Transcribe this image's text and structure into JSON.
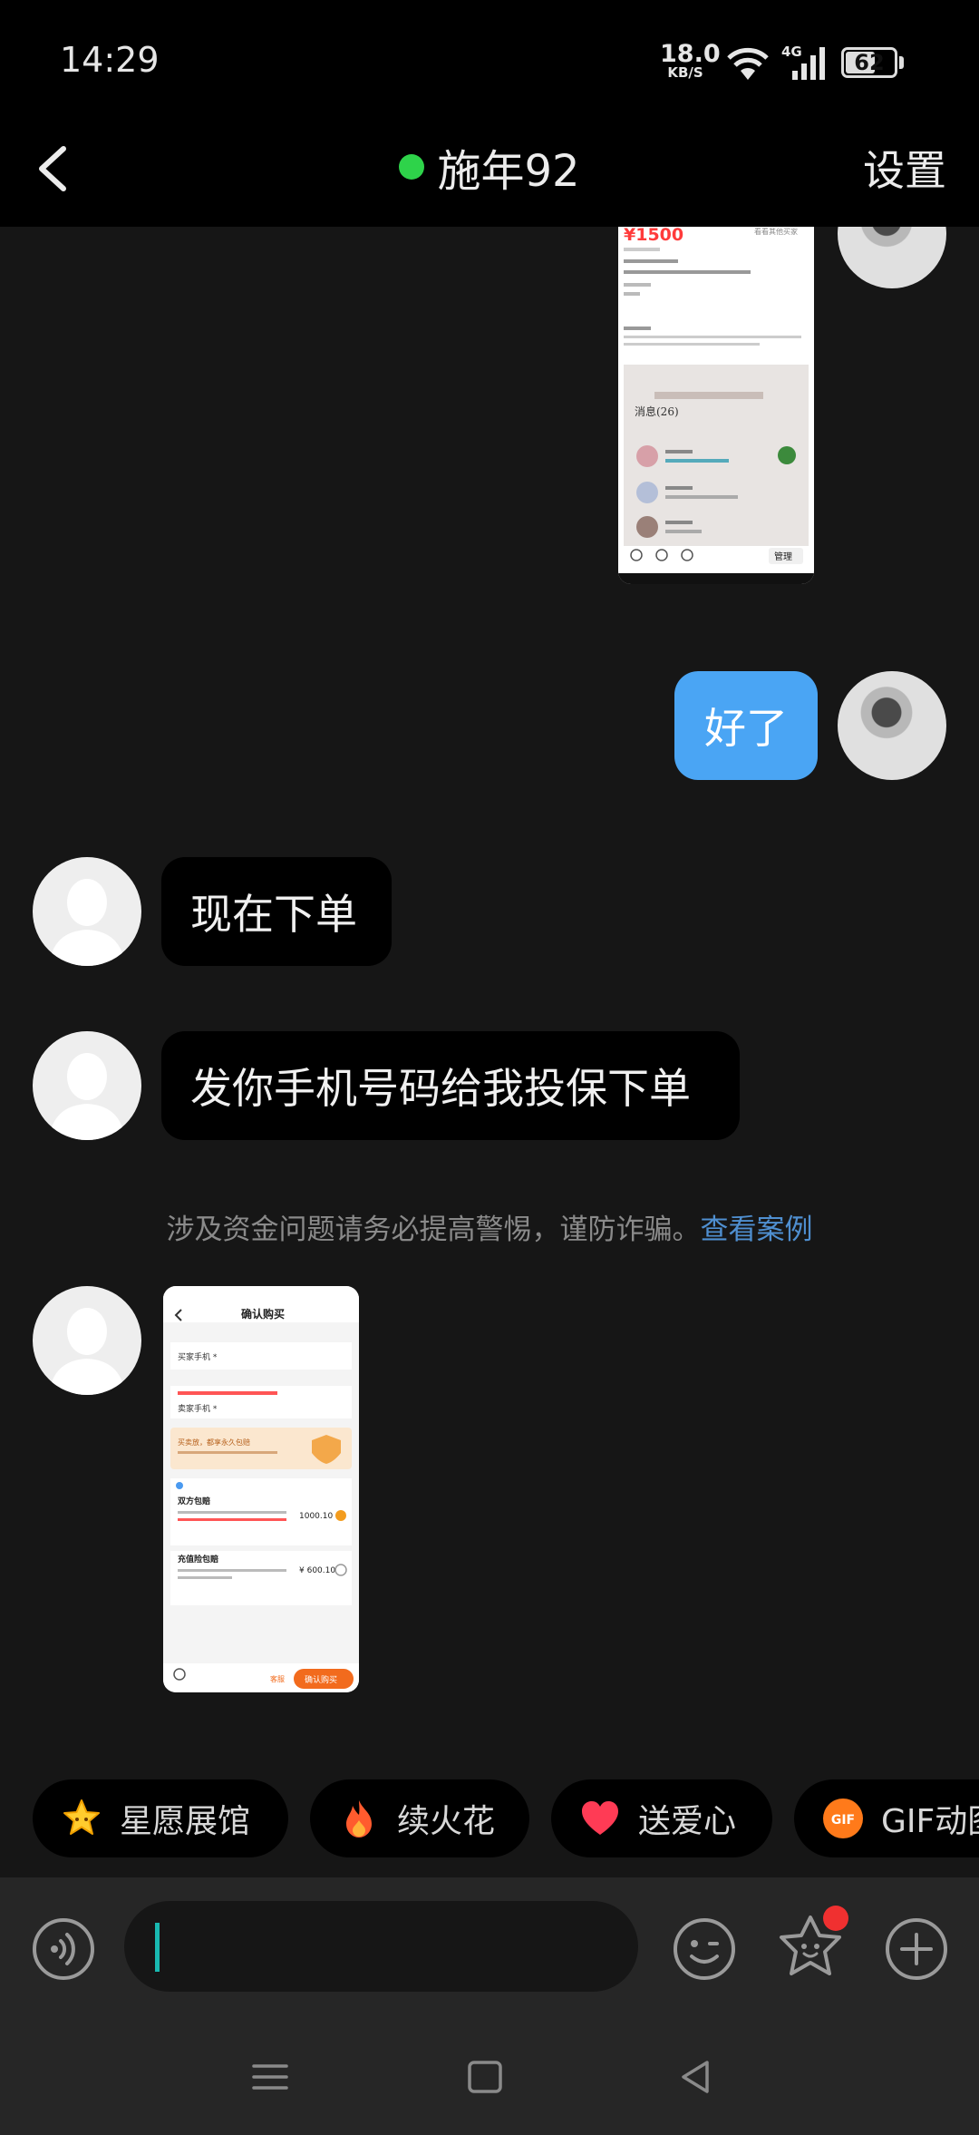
{
  "status_bar": {
    "time": "14:29",
    "net_speed": "18.0",
    "net_unit": "KB/S",
    "network_type": "4G",
    "battery": "62",
    "battery_level": 0.62
  },
  "header": {
    "title": "施年92",
    "settings_label": "设置",
    "online_color": "#2ed34a"
  },
  "messages": [
    {
      "from": "me",
      "type": "image"
    },
    {
      "from": "me",
      "type": "text",
      "text": "好了"
    },
    {
      "from": "other",
      "type": "text",
      "text": "现在下单"
    },
    {
      "from": "other",
      "type": "text",
      "text": "发你手机号码给我投保下单"
    },
    {
      "from": "system",
      "type": "notice",
      "text": "涉及资金问题请务必提高警惕，谨防诈骗。",
      "link": "查看案例"
    },
    {
      "from": "other",
      "type": "image"
    }
  ],
  "shot1": {
    "price": "¥1500",
    "header_text": "看看其他买家",
    "section_title": "消息(26)",
    "manage_label": "管理"
  },
  "shot2": {
    "title": "确认购买",
    "buyer_phone_label": "买家手机 *",
    "seller_phone_label": "卖家手机 *",
    "promo_title": "买卖放，都享永久包赔",
    "option1_label": "双方包赔",
    "option1_price": "1000.10",
    "option2_label": "充值险包赔",
    "option2_price": "¥ 600.10",
    "left_btn": "客服",
    "confirm_btn": "确认购买"
  },
  "quick_actions": [
    {
      "label": "星愿展馆",
      "icon": "star-icon"
    },
    {
      "label": "续火花",
      "icon": "flame-icon"
    },
    {
      "label": "送爱心",
      "icon": "heart-icon"
    },
    {
      "label": "GIF动图",
      "icon": "gif-icon",
      "badge": "GIF"
    }
  ],
  "colors": {
    "accent_blue": "#4aa5f4",
    "link_blue": "#4f8fd0",
    "caret": "#19b9b1",
    "badge_red": "#f03030"
  }
}
